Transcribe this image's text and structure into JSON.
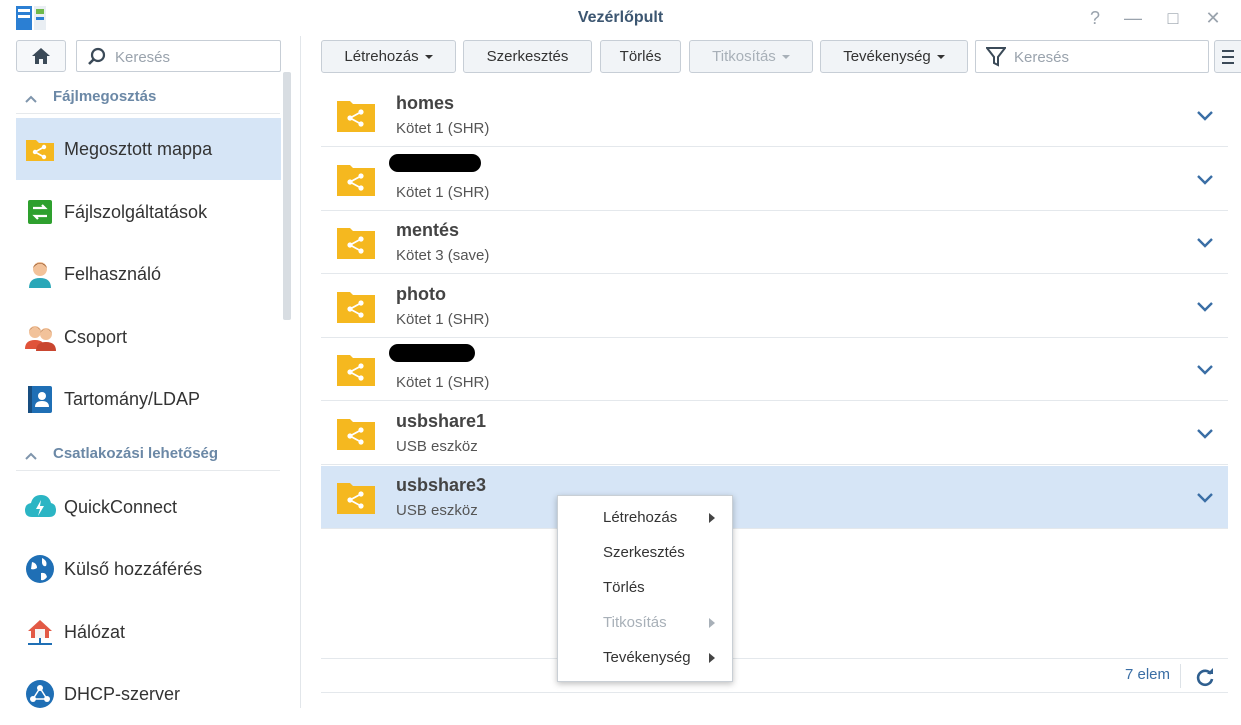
{
  "window": {
    "title": "Vezérlőpult",
    "help": "?",
    "minimize": "—",
    "maximize": "□",
    "close": "✕"
  },
  "sidebar": {
    "search_placeholder": "Keresés",
    "sections": [
      {
        "label": "Fájlmegosztás",
        "items": [
          {
            "label": "Megosztott mappa",
            "icon": "shared-folder-icon",
            "active": true
          },
          {
            "label": "Fájlszolgáltatások",
            "icon": "file-services-icon"
          },
          {
            "label": "Felhasználó",
            "icon": "user-icon"
          },
          {
            "label": "Csoport",
            "icon": "group-icon"
          },
          {
            "label": "Tartomány/LDAP",
            "icon": "domain-ldap-icon"
          }
        ]
      },
      {
        "label": "Csatlakozási lehetőség",
        "items": [
          {
            "label": "QuickConnect",
            "icon": "quickconnect-icon"
          },
          {
            "label": "Külső hozzáférés",
            "icon": "globe-icon"
          },
          {
            "label": "Hálózat",
            "icon": "network-icon"
          },
          {
            "label": "DHCP-szerver",
            "icon": "dhcp-icon"
          }
        ]
      }
    ]
  },
  "toolbar": {
    "create": "Létrehozás",
    "edit": "Szerkesztés",
    "delete": "Törlés",
    "encrypt": "Titkosítás",
    "action": "Tevékenység",
    "search_placeholder": "Keresés"
  },
  "folders": [
    {
      "name": "homes",
      "volume": "Kötet 1 (SHR)"
    },
    {
      "name": "",
      "volume": "Kötet 1 (SHR)",
      "redacted": true
    },
    {
      "name": "mentés",
      "volume": "Kötet 3 (save)"
    },
    {
      "name": "photo",
      "volume": "Kötet 1 (SHR)"
    },
    {
      "name": "",
      "volume": "Kötet 1 (SHR)",
      "redacted": true
    },
    {
      "name": "usbshare1",
      "volume": "USB eszköz"
    },
    {
      "name": "usbshare3",
      "volume": "USB eszköz",
      "selected": true
    }
  ],
  "footer": {
    "count": "7 elem"
  },
  "context_menu": [
    {
      "label": "Létrehozás",
      "submenu": true,
      "disabled": false
    },
    {
      "label": "Szerkesztés",
      "submenu": false,
      "disabled": false
    },
    {
      "label": "Törlés",
      "submenu": false,
      "disabled": false
    },
    {
      "label": "Titkosítás",
      "submenu": true,
      "disabled": true
    },
    {
      "label": "Tevékenység",
      "submenu": true,
      "disabled": false
    }
  ],
  "colors": {
    "accent": "#3a6ea5",
    "folder": "#f5b81f",
    "selected_row": "#d6e5f6"
  }
}
